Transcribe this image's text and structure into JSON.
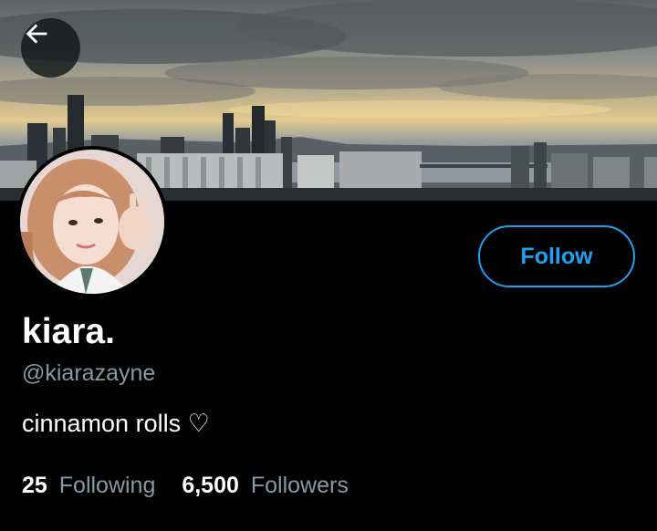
{
  "header": {
    "back_icon": "arrow-left-icon"
  },
  "profile": {
    "display_name": "kiara.",
    "handle": "@kiarazayne",
    "bio": "cinnamon rolls ♡",
    "follow_label": "Follow"
  },
  "stats": {
    "following_count": "25",
    "following_label": "Following",
    "followers_count": "6,500",
    "followers_label": "Followers"
  },
  "colors": {
    "background": "#000000",
    "accent": "#1da1f2",
    "secondary_text": "#8899a6",
    "primary_text": "#ffffff"
  }
}
